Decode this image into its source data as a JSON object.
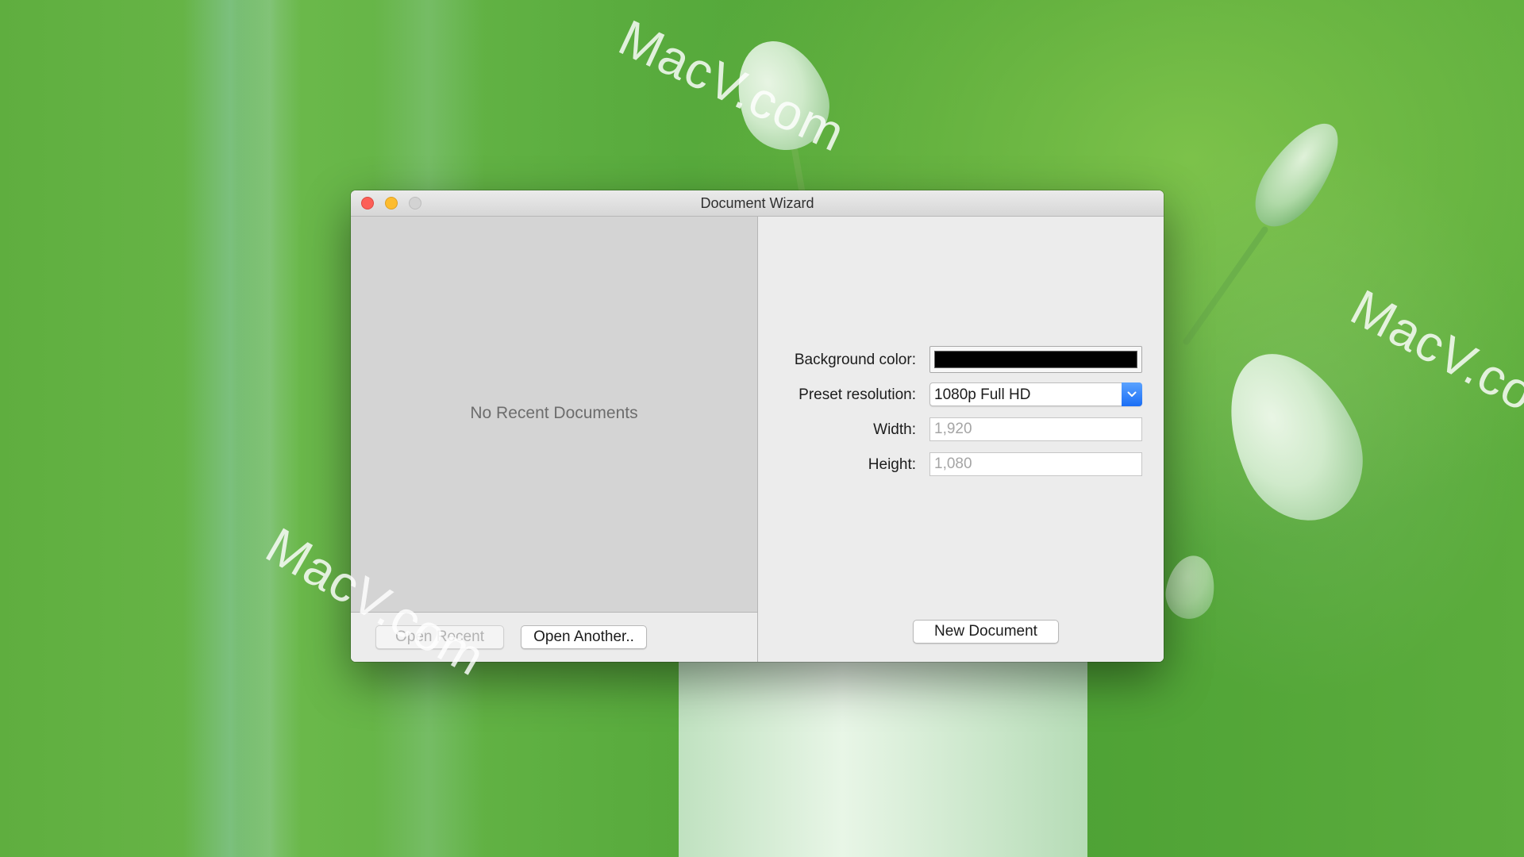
{
  "watermarks": [
    "MacV.com",
    "MacV.co",
    "MacV.com"
  ],
  "window": {
    "title": "Document Wizard",
    "controls": {
      "close_color": "#fc5f57",
      "minimize_color": "#fdbc2e",
      "zoom_color": "#d3d3d3"
    }
  },
  "recent": {
    "empty_text": "No Recent Documents",
    "open_recent_label": "Open Recent",
    "open_recent_disabled": true,
    "open_another_label": "Open Another.."
  },
  "form": {
    "background_color_label": "Background color:",
    "background_color_value": "#000000",
    "preset_label": "Preset resolution:",
    "preset_value": "1080p Full HD",
    "width_label": "Width:",
    "width_value": "1,920",
    "height_label": "Height:",
    "height_value": "1,080",
    "new_document_label": "New Document"
  },
  "icons": {
    "dropdown": "chevron-down-icon"
  }
}
